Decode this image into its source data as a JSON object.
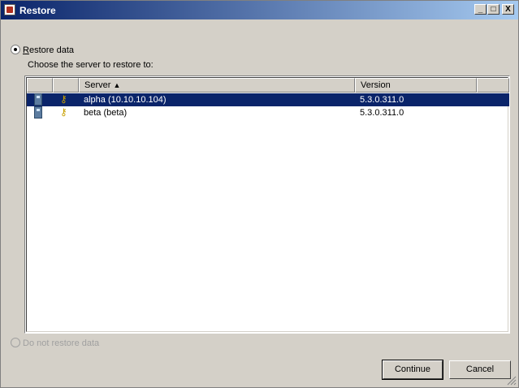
{
  "window": {
    "title": "Restore"
  },
  "titlebar_buttons": {
    "minimize": "_",
    "maximize": "□",
    "close": "X"
  },
  "restore_option": {
    "label": "Restore data",
    "accelerator": "R",
    "selected": true
  },
  "server_prompt": "Choose the server to restore to:",
  "columns": {
    "icon": "",
    "key": "",
    "server": "Server",
    "sort_indicator": "▲",
    "version": "Version",
    "extra": ""
  },
  "servers": [
    {
      "name": "alpha (10.10.10.104)",
      "version": "5.3.0.311.0",
      "selected": true,
      "icon": "server-icon",
      "key_icon": "key-icon"
    },
    {
      "name": "beta (beta)",
      "version": "5.3.0.311.0",
      "selected": false,
      "icon": "server-icon",
      "key_icon": "key-icon"
    }
  ],
  "no_restore_option": {
    "label": "Do not restore data",
    "selected": false,
    "enabled": false
  },
  "buttons": {
    "continue": "Continue",
    "cancel": "Cancel"
  },
  "colors": {
    "title_start": "#0a246a",
    "title_end": "#a6caf0",
    "selection": "#0a246a",
    "face": "#d4d0c8"
  }
}
